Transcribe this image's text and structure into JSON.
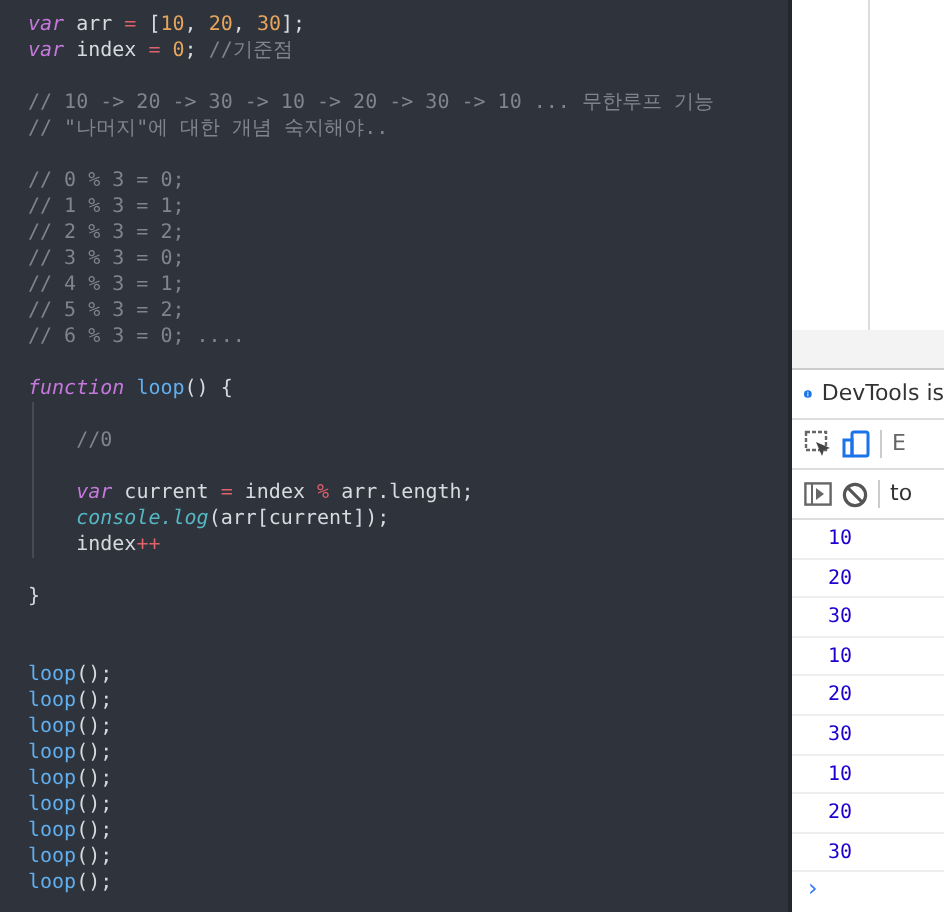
{
  "editor": {
    "lines": [
      {
        "kind": "code",
        "tokens": [
          {
            "text": "var",
            "kind": "keyword"
          },
          {
            "text": " arr ",
            "kind": "plain"
          },
          {
            "text": "=",
            "kind": "operator"
          },
          {
            "text": " [",
            "kind": "plain"
          },
          {
            "text": "10",
            "kind": "number"
          },
          {
            "text": ", ",
            "kind": "plain"
          },
          {
            "text": "20",
            "kind": "number"
          },
          {
            "text": ", ",
            "kind": "plain"
          },
          {
            "text": "30",
            "kind": "number"
          },
          {
            "text": "];",
            "kind": "plain"
          }
        ]
      },
      {
        "kind": "code",
        "tokens": [
          {
            "text": "var",
            "kind": "keyword"
          },
          {
            "text": " index ",
            "kind": "plain"
          },
          {
            "text": "= ",
            "kind": "operator"
          },
          {
            "text": "0",
            "kind": "number"
          },
          {
            "text": "; ",
            "kind": "plain"
          },
          {
            "text": "//기준점",
            "kind": "comment"
          }
        ]
      },
      {
        "kind": "blank"
      },
      {
        "kind": "code",
        "tokens": [
          {
            "text": "// 10 -> 20 -> 30 -> 10 -> 20 -> 30 -> 10 ... 무한루프 기능",
            "kind": "comment"
          }
        ]
      },
      {
        "kind": "code",
        "tokens": [
          {
            "text": "// \"나머지\"에 대한 개념 숙지해야..",
            "kind": "comment"
          }
        ]
      },
      {
        "kind": "blank"
      },
      {
        "kind": "code",
        "tokens": [
          {
            "text": "// 0 % 3 = 0;",
            "kind": "comment"
          }
        ]
      },
      {
        "kind": "code",
        "tokens": [
          {
            "text": "// 1 % 3 = 1;",
            "kind": "comment"
          }
        ]
      },
      {
        "kind": "code",
        "tokens": [
          {
            "text": "// 2 % 3 = 2;",
            "kind": "comment"
          }
        ]
      },
      {
        "kind": "code",
        "tokens": [
          {
            "text": "// 3 % 3 = 0;",
            "kind": "comment"
          }
        ]
      },
      {
        "kind": "code",
        "tokens": [
          {
            "text": "// 4 % 3 = 1;",
            "kind": "comment"
          }
        ]
      },
      {
        "kind": "code",
        "tokens": [
          {
            "text": "// 5 % 3 = 2;",
            "kind": "comment"
          }
        ]
      },
      {
        "kind": "code",
        "tokens": [
          {
            "text": "// 6 % 3 = 0; ....",
            "kind": "comment"
          }
        ]
      },
      {
        "kind": "blank"
      },
      {
        "kind": "code",
        "tokens": [
          {
            "text": "function ",
            "kind": "keyword"
          },
          {
            "text": "loop",
            "kind": "function"
          },
          {
            "text": "() {",
            "kind": "plain"
          }
        ]
      },
      {
        "kind": "blank"
      },
      {
        "kind": "code",
        "tokens": [
          {
            "text": "    //0",
            "kind": "comment"
          }
        ]
      },
      {
        "kind": "blank"
      },
      {
        "kind": "code",
        "tokens": [
          {
            "text": "    var",
            "kind": "keyword"
          },
          {
            "text": " current ",
            "kind": "plain"
          },
          {
            "text": "=",
            "kind": "operator"
          },
          {
            "text": " index ",
            "kind": "plain"
          },
          {
            "text": "%",
            "kind": "operator"
          },
          {
            "text": " arr.length;",
            "kind": "plain"
          }
        ]
      },
      {
        "kind": "code",
        "tokens": [
          {
            "text": "    console.log",
            "kind": "builtin"
          },
          {
            "text": "(arr[current]);",
            "kind": "plain"
          }
        ]
      },
      {
        "kind": "code",
        "tokens": [
          {
            "text": "    index",
            "kind": "plain"
          },
          {
            "text": "++",
            "kind": "operator"
          }
        ]
      },
      {
        "kind": "blank"
      },
      {
        "kind": "code",
        "tokens": [
          {
            "text": "}",
            "kind": "plain"
          }
        ]
      },
      {
        "kind": "blank"
      },
      {
        "kind": "blank"
      },
      {
        "kind": "code",
        "tokens": [
          {
            "text": "loop",
            "kind": "function"
          },
          {
            "text": "();",
            "kind": "plain"
          }
        ]
      },
      {
        "kind": "code",
        "tokens": [
          {
            "text": "loop",
            "kind": "function"
          },
          {
            "text": "();",
            "kind": "plain"
          }
        ]
      },
      {
        "kind": "code",
        "tokens": [
          {
            "text": "loop",
            "kind": "function"
          },
          {
            "text": "();",
            "kind": "plain"
          }
        ]
      },
      {
        "kind": "code",
        "tokens": [
          {
            "text": "loop",
            "kind": "function"
          },
          {
            "text": "();",
            "kind": "plain"
          }
        ]
      },
      {
        "kind": "code",
        "tokens": [
          {
            "text": "loop",
            "kind": "function"
          },
          {
            "text": "();",
            "kind": "plain"
          }
        ]
      },
      {
        "kind": "code",
        "tokens": [
          {
            "text": "loop",
            "kind": "function"
          },
          {
            "text": "();",
            "kind": "plain"
          }
        ]
      },
      {
        "kind": "code",
        "tokens": [
          {
            "text": "loop",
            "kind": "function"
          },
          {
            "text": "();",
            "kind": "plain"
          }
        ]
      },
      {
        "kind": "code",
        "tokens": [
          {
            "text": "loop",
            "kind": "function"
          },
          {
            "text": "();",
            "kind": "plain"
          }
        ]
      },
      {
        "kind": "code",
        "tokens": [
          {
            "text": "loop",
            "kind": "function"
          },
          {
            "text": "();",
            "kind": "plain"
          }
        ]
      }
    ]
  },
  "devtools": {
    "info_bar": "DevTools is",
    "toolbar_tab": "E",
    "context_selector": "to",
    "console_output": [
      "10",
      "20",
      "30",
      "10",
      "20",
      "30",
      "10",
      "20",
      "30"
    ],
    "prompt": "›"
  }
}
